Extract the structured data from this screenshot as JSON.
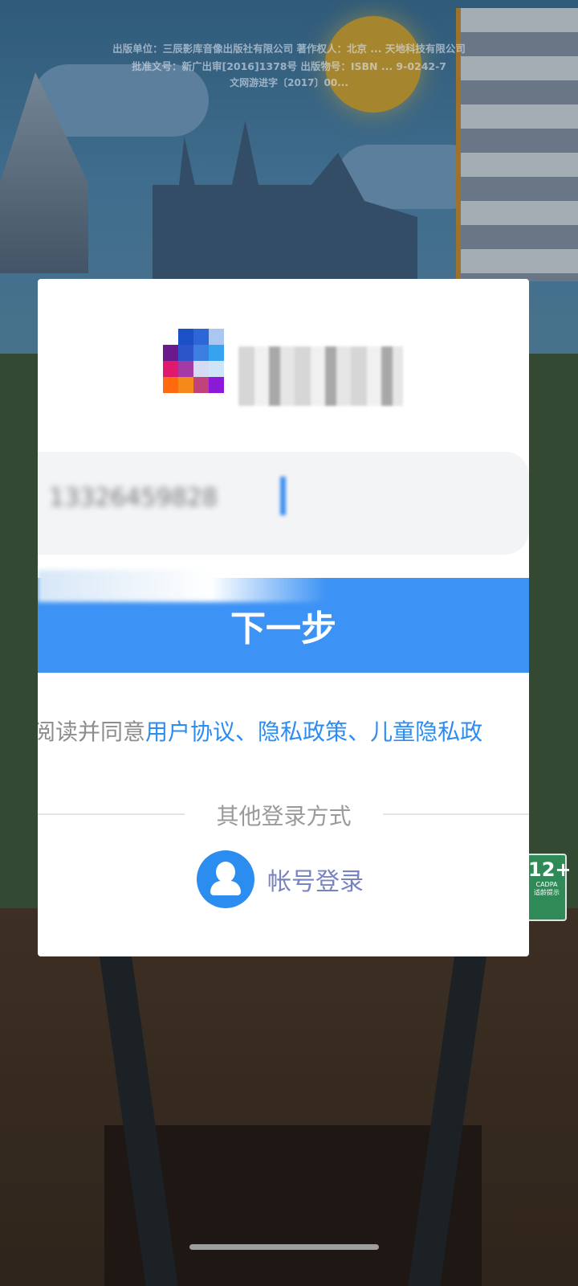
{
  "publisher_info": {
    "line1": "出版单位：三辰影库音像出版社有限公司 著作权人：北京 ... 天地科技有限公司",
    "line2": "批准文号：新广出审[2016]1378号 出版物号：ISBN ... 9-0242-7",
    "line3": "文网游进字〔2017〕00..."
  },
  "age_rating": {
    "value": "12+",
    "label": "CADPA",
    "note": "适龄提示"
  },
  "login": {
    "phone_value": "13326459828",
    "next_button": "下一步",
    "agreement_prefix": "阅读并同意",
    "agreement_links": [
      "用户协议",
      "隐私政策",
      "儿童隐私政"
    ],
    "agreement_separator": "、",
    "other_methods_label": "其他登录方式",
    "account_login_label": "帐号登录"
  },
  "colors": {
    "primary_blue": "#3d93f5",
    "link_blue": "#2d8cf0",
    "account_label": "#7884c0"
  }
}
